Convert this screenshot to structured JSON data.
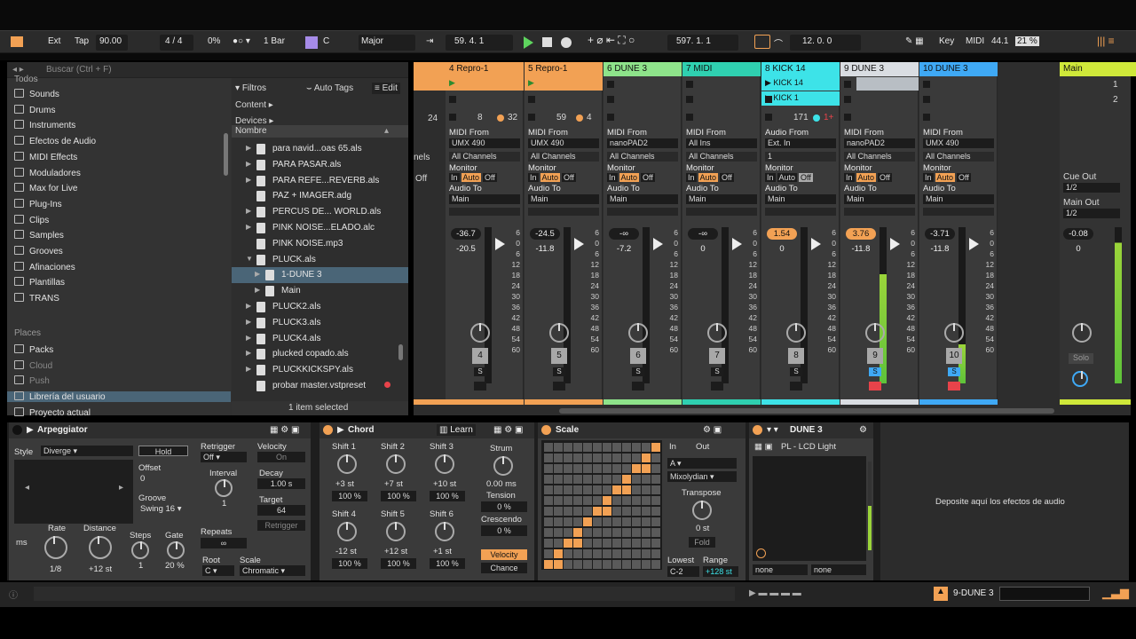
{
  "topbar": {
    "ext": "Ext",
    "tap": "Tap",
    "tempo": "90.00",
    "time_sig": "4 / 4",
    "swing": "0%",
    "quant": "1 Bar",
    "key_root": "C",
    "scale": "Major",
    "position": "59.   4.   1",
    "loop_start": "597.   1.   1",
    "loop_len": "12.   0.   0",
    "key_label": "Key",
    "midi_label": "MIDI",
    "sample_rate": "44.1",
    "cpu": "21 %"
  },
  "browser": {
    "search_placeholder": "Buscar (Ctrl + F)",
    "categories_label": "Todos",
    "sidebar": [
      "Sounds",
      "Drums",
      "Instruments",
      "Efectos de Audio",
      "MIDI Effects",
      "Moduladores",
      "Max for Live",
      "Plug-Ins",
      "Clips",
      "Samples",
      "Grooves",
      "Afinaciones",
      "Plantillas",
      "TRANS"
    ],
    "places_label": "Places",
    "places": [
      "Packs",
      "Cloud",
      "Push",
      "Librería del usuario",
      "Proyecto actual"
    ],
    "filters": "Filtros",
    "auto_tags": "Auto Tags",
    "edit": "Edit",
    "content": "Content ▸",
    "devices": "Devices ▸",
    "col_name": "Nombre",
    "files": [
      "para navid...oas 65.als",
      "PARA PASAR.als",
      "PARA REFE...REVERB.als",
      "PAZ + IMAGER.adg",
      "PERCUS DE... WORLD.als",
      "PINK NOISE...ELADO.alc",
      "PINK NOISE.mp3",
      "PLUCK.als",
      "1-DUNE 3",
      "Main",
      "PLUCK2.als",
      "PLUCK3.als",
      "PLUCK4.als",
      "plucked copado.als",
      "PLUCKKICKSPY.als",
      "probar master.vstpreset"
    ],
    "status": "1 item selected"
  },
  "tracks": [
    {
      "name": "4 Repro-1",
      "color": "#f2a154",
      "num": "4",
      "from": "MIDI From",
      "src": "UMX 490",
      "ch": "All Channels",
      "to": "Audio To",
      "dst": "Main",
      "vol": "-36.7",
      "pk": "-20.5",
      "s1": "8",
      "s2": "32"
    },
    {
      "name": "5 Repro-1",
      "color": "#f2a154",
      "num": "5",
      "from": "MIDI From",
      "src": "UMX 490",
      "ch": "All Channels",
      "to": "Audio To",
      "dst": "Main",
      "vol": "-24.5",
      "pk": "-11.8",
      "s1": "59",
      "s2": "4"
    },
    {
      "name": "6 DUNE 3",
      "color": "#8ee38a",
      "num": "6",
      "from": "MIDI From",
      "src": "nanoPAD2",
      "ch": "All Channels",
      "to": "Audio To",
      "dst": "Main",
      "vol": "-∞",
      "pk": "-7.2",
      "s1": "",
      "s2": ""
    },
    {
      "name": "7 MIDI",
      "color": "#2fd0b0",
      "num": "7",
      "from": "MIDI From",
      "src": "All Ins",
      "ch": "All Channels",
      "to": "Audio To",
      "dst": "Main",
      "vol": "-∞",
      "pk": "0",
      "s1": "",
      "s2": ""
    },
    {
      "name": "8 KICK 14",
      "color": "#3de3e8",
      "num": "8",
      "from": "Audio From",
      "src": "Ext. In",
      "ch": "1",
      "to": "Audio To",
      "dst": "Main",
      "vol": "1.54",
      "pk": "0",
      "s1": "171",
      "s2": "1+"
    },
    {
      "name": "9 DUNE 3",
      "color": "#d9dde2",
      "num": "9",
      "from": "MIDI From",
      "src": "nanoPAD2",
      "ch": "All Channels",
      "to": "Audio To",
      "dst": "Main",
      "vol": "3.76",
      "pk": "-11.8",
      "s1": "",
      "s2": ""
    },
    {
      "name": "10 DUNE 3",
      "color": "#3fa9f5",
      "num": "10",
      "from": "MIDI From",
      "src": "UMX 490",
      "ch": "All Channels",
      "to": "Audio To",
      "dst": "Main",
      "vol": "-3.71",
      "pk": "-11.8",
      "s1": "",
      "s2": ""
    }
  ],
  "mixer_labels": {
    "monitor": "Monitor",
    "in": "In",
    "auto": "Auto",
    "off": "Off",
    "s": "S",
    "kick_clip1": "KICK 14",
    "kick_clip2": "KICK 1",
    "partial_left": "nels",
    "partial_off": "Off",
    "partial_24": "24"
  },
  "master": {
    "name": "Main",
    "cue_out": "Cue Out",
    "cue_val": "1/2",
    "main_out": "Main Out",
    "main_val": "1/2",
    "vol": "-0.08",
    "pk": "0",
    "solo": "Solo",
    "scene1": "1",
    "scene2": "2"
  },
  "meter_scale": [
    "6",
    "0",
    "6",
    "12",
    "18",
    "24",
    "30",
    "36",
    "42",
    "48",
    "54",
    "60"
  ],
  "arp": {
    "title": "Arpeggiator",
    "style": "Style",
    "style_val": "Diverge",
    "hold": "Hold",
    "offset": "Offset",
    "offset_val": "0",
    "groove": "Groove",
    "groove_val": "Swing 16",
    "rate": "Rate",
    "rate_val": "1/8",
    "distance": "Distance",
    "distance_val": "+12 st",
    "steps": "Steps",
    "steps_val": "1",
    "gate": "Gate",
    "gate_val": "20 %",
    "retrigger": "Retrigger",
    "retrigger_val": "Off",
    "interval": "Interval",
    "interval_val": "1",
    "repeats": "Repeats",
    "repeats_val": "∞",
    "velocity": "Velocity",
    "velocity_val": "On",
    "decay": "Decay",
    "decay_val": "1.00 s",
    "target": "Target",
    "target_val": "64",
    "retrig_btn": "Retrigger",
    "root": "Root",
    "root_val": "C",
    "scale": "Scale",
    "scale_val": "Chromatic",
    "ms": "ms"
  },
  "chord": {
    "title": "Chord",
    "learn": "Learn",
    "shifts": [
      {
        "l": "Shift 1",
        "st": "+3 st",
        "p": "100 %"
      },
      {
        "l": "Shift 2",
        "st": "+7 st",
        "p": "100 %"
      },
      {
        "l": "Shift 3",
        "st": "+10 st",
        "p": "100 %"
      },
      {
        "l": "Shift 4",
        "st": "-12 st",
        "p": "100 %"
      },
      {
        "l": "Shift 5",
        "st": "+12 st",
        "p": "100 %"
      },
      {
        "l": "Shift 6",
        "st": "+1 st",
        "p": "100 %"
      }
    ],
    "strum": "Strum",
    "strum_val": "0.00 ms",
    "tension": "Tension",
    "tension_val": "0 %",
    "crescendo": "Crescendo",
    "crescendo_val": "0 %",
    "velocity": "Velocity",
    "chance": "Chance"
  },
  "scale_dev": {
    "title": "Scale",
    "in": "In",
    "out": "Out",
    "base": "A",
    "mode": "Mixolydian",
    "transpose": "Transpose",
    "transpose_val": "0 st",
    "fold": "Fold",
    "lowest": "Lowest",
    "lowest_val": "C-2",
    "range": "Range",
    "range_val": "+128 st"
  },
  "dune": {
    "title": "DUNE 3",
    "preset": "PL - LCD Light",
    "none1": "none",
    "none2": "none"
  },
  "drop_hint": "Deposite aquí los efectos de audio",
  "statusbar": {
    "track": "9-DUNE 3"
  },
  "colors": {
    "orange": "#f2a154",
    "bg": "#2d2d2d"
  }
}
